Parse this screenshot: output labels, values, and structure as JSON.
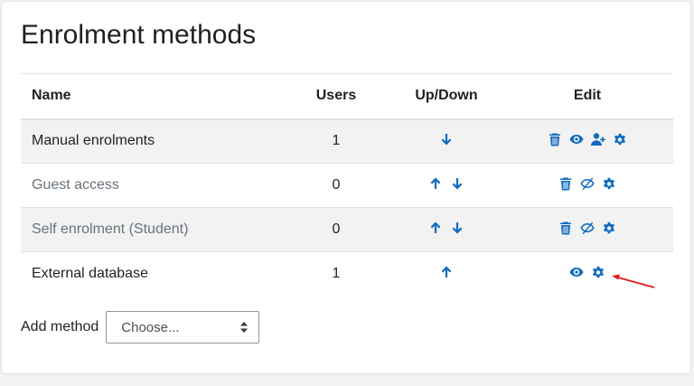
{
  "page": {
    "title": "Enrolment methods"
  },
  "table": {
    "headers": {
      "name": "Name",
      "users": "Users",
      "updown": "Up/Down",
      "edit": "Edit"
    },
    "rows": [
      {
        "name": "Manual enrolments",
        "users": "1",
        "dimmed": false,
        "updown_icons": [
          "arrow-down-icon"
        ],
        "edit_icons": [
          "delete-icon",
          "show-icon",
          "enrol-users-icon",
          "settings-icon"
        ]
      },
      {
        "name": "Guest access",
        "users": "0",
        "dimmed": true,
        "updown_icons": [
          "arrow-up-icon",
          "arrow-down-icon"
        ],
        "edit_icons": [
          "delete-icon",
          "hidden-icon",
          "settings-icon"
        ]
      },
      {
        "name": "Self enrolment (Student)",
        "users": "0",
        "dimmed": true,
        "updown_icons": [
          "arrow-up-icon",
          "arrow-down-icon"
        ],
        "edit_icons": [
          "delete-icon",
          "hidden-icon",
          "settings-icon"
        ]
      },
      {
        "name": "External database",
        "users": "1",
        "dimmed": false,
        "updown_icons": [
          "arrow-up-icon"
        ],
        "edit_icons": [
          "show-icon",
          "settings-icon"
        ]
      }
    ]
  },
  "add_method": {
    "label": "Add method",
    "select_value": "Choose..."
  },
  "colors": {
    "icon": "#0f6cbf",
    "dimmed_text": "#6a737b",
    "stripe": "#f2f2f2",
    "annotation_arrow": "#e01b1b"
  },
  "annotation": {
    "icon": "red-arrow-icon"
  }
}
